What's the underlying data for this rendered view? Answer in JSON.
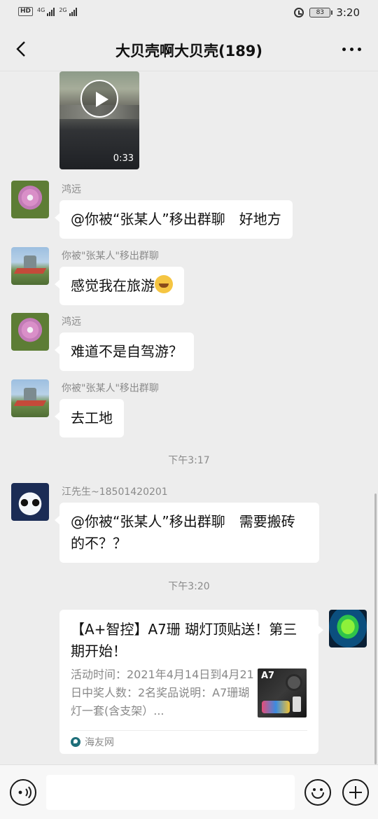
{
  "status_bar": {
    "hd": "HD",
    "network_1": "4G",
    "network_2": "2G",
    "battery": "83",
    "time": "3:20"
  },
  "header": {
    "title": "大贝壳啊大贝壳(189)"
  },
  "video": {
    "duration": "0:33"
  },
  "messages": [
    {
      "sender": "鸿远",
      "text": "@你被“张某人”移出群聊　好地方"
    },
    {
      "sender": "你被\"张某人\"移出群聊",
      "text": "感觉我在旅游"
    },
    {
      "sender": "鸿远",
      "text": "难道不是自驾游？"
    },
    {
      "sender": "你被\"张某人\"移出群聊",
      "text": "去工地"
    },
    {
      "sender": "江先生~18501420201",
      "text": "@你被“张某人”移出群聊　需要搬砖的不？？"
    }
  ],
  "timestamps": [
    "下午3:17",
    "下午3:20"
  ],
  "link_card": {
    "title": "【A+智控】A7珊 瑚灯顶贴送！第三期开始！",
    "description": "活动时间：2021年4月14日到4月21日中奖人数：2名奖品说明：A7珊瑚灯一套(含支架）...",
    "thumb_label": "A7",
    "source": "海友网"
  },
  "icons": {
    "back": "chevron-left-icon",
    "more": "more-dots-icon",
    "play": "play-icon",
    "voice": "voice-icon",
    "emoji": "emoji-icon",
    "plus": "plus-icon"
  },
  "colors": {
    "background": "#ededed",
    "bubble": "#ffffff",
    "secondary_text": "#8a8a8a"
  }
}
